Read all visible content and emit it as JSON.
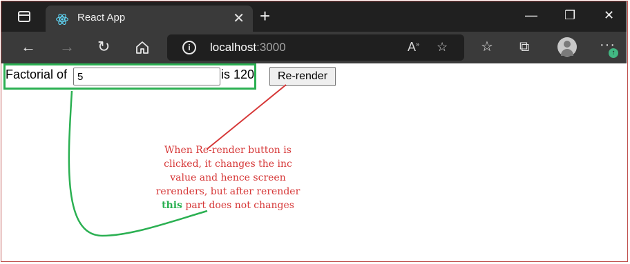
{
  "browser": {
    "tab_title": "React App",
    "tab_close": "✕",
    "new_tab": "+",
    "url_host": "localhost",
    "url_port": ":3000",
    "window_controls": {
      "minimize": "—",
      "restore": "❐",
      "close": "✕"
    },
    "icons": [
      "tab-actions-icon",
      "react-icon",
      "back-icon",
      "forward-icon",
      "refresh-icon",
      "home-icon",
      "info-icon",
      "read-aloud-icon",
      "add-favorite-icon",
      "favorites-icon",
      "collections-icon",
      "profile-icon",
      "menu-icon",
      "update-icon"
    ]
  },
  "app": {
    "factorial_label": "Factorial of",
    "input_value": "5",
    "result_text": "is 120",
    "rerender_button": "Re-render"
  },
  "annotation": {
    "text_before": "When Re-render button is clicked, it changes the inc value and hence screen rerenders, but after rerender",
    "highlight": "this",
    "text_after": "part does not changes",
    "colors": {
      "text": "#d63737",
      "highlight": "#2bb052",
      "box": "#2bb052",
      "connector": "#d63737"
    }
  }
}
